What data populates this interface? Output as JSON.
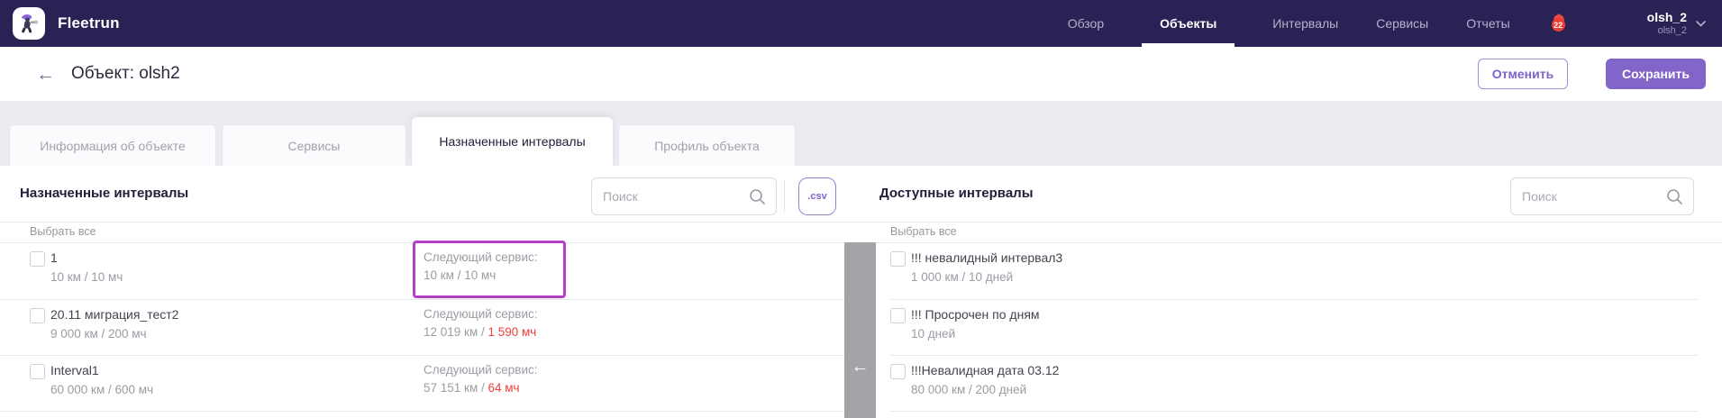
{
  "colors": {
    "header_bg": "#292254",
    "accent_purple": "#8165c9",
    "notification_red": "#ee3b35",
    "alert_red": "#ee3e3e",
    "magenta_highlight": "#b23fc6",
    "divider_strip_gray": "#a3a3a8"
  },
  "icons": {
    "back_arrow": "←",
    "move_left_arrow": "←"
  },
  "header": {
    "brand": "Fleetrun",
    "nav": {
      "overview": "Обзор",
      "objects": "Объекты",
      "intervals": "Интервалы",
      "services": "Сервисы",
      "reports": "Отчеты"
    },
    "notifications": {
      "count": "22"
    },
    "user": {
      "name": "olsh_2",
      "account": "olsh_2"
    }
  },
  "subheader": {
    "title": "Объект: olsh2",
    "cancel": "Отменить",
    "save": "Сохранить"
  },
  "tabs": {
    "info": "Информация об объекте",
    "services": "Сервисы",
    "assigned_intervals": "Назначенные интервалы",
    "profile": "Профиль объекта"
  },
  "assigned": {
    "title": "Назначенные интервалы",
    "search_placeholder": "Поиск",
    "csv": ".csv",
    "select_all": "Выбрать все",
    "rows": [
      {
        "name": "1",
        "spec": "10 км / 10 мч",
        "next_label": "Следующий сервис:",
        "next_ok": "10 км / 10 мч",
        "next_alert": ""
      },
      {
        "name": "20.11 миграция_тест2",
        "spec": "9 000 км / 200 мч",
        "next_label": "Следующий сервис:",
        "next_ok": "12 019 км / ",
        "next_alert": "1 590 мч"
      },
      {
        "name": "Interval1",
        "spec": "60 000 км / 600 мч",
        "next_label": "Следующий сервис:",
        "next_ok": "57 151 км / ",
        "next_alert": "64 мч"
      }
    ]
  },
  "available": {
    "title": "Доступные интервалы",
    "search_placeholder": "Поиск",
    "select_all": "Выбрать все",
    "rows": [
      {
        "name": "!!! невалидный интервал3",
        "spec": "1 000 км / 10 дней"
      },
      {
        "name": "!!! Просрочен по дням",
        "spec": "10 дней"
      },
      {
        "name": "!!!Невалидная дата 03.12",
        "spec": "80 000 км / 200 дней"
      }
    ]
  }
}
